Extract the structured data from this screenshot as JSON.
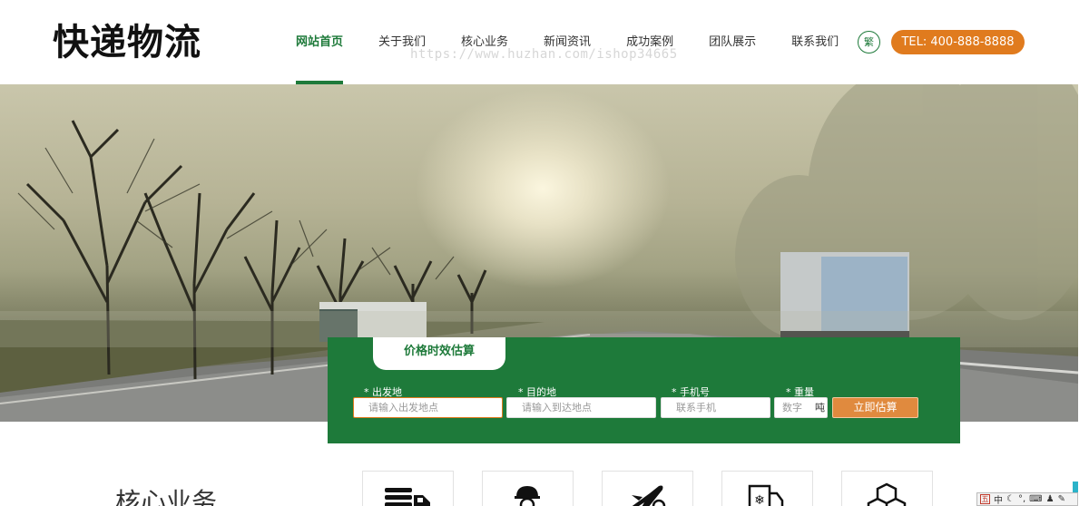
{
  "header": {
    "logo": "快递物流",
    "nav": [
      {
        "label": "网站首页",
        "active": true
      },
      {
        "label": "关于我们"
      },
      {
        "label": "核心业务"
      },
      {
        "label": "新闻资讯"
      },
      {
        "label": "成功案例"
      },
      {
        "label": "团队展示"
      },
      {
        "label": "联系我们"
      }
    ],
    "lang_toggle": "繁",
    "tel": "TEL: 400-888-8888",
    "watermark": "https://www.huzhan.com/ishop34665"
  },
  "calculator": {
    "tab": "价格时效估算",
    "fields": [
      {
        "label": "* 出发地",
        "placeholder": "请输入出发地点"
      },
      {
        "label": "* 目的地",
        "placeholder": "请输入到达地点"
      },
      {
        "label": "* 手机号",
        "placeholder": "联系手机"
      },
      {
        "label": "* 重量",
        "placeholder": "数字",
        "unit": "吨"
      }
    ],
    "submit": "立即估算"
  },
  "core": {
    "title": "核心业务",
    "services": [
      {
        "icon": "truck-stack-icon"
      },
      {
        "icon": "courier-person-icon"
      },
      {
        "icon": "airplane-icon"
      },
      {
        "icon": "cold-chain-truck-icon"
      },
      {
        "icon": "boxes-icon"
      }
    ]
  },
  "ime": {
    "badge": "五",
    "mode": "中"
  },
  "colors": {
    "brand_green": "#1e7a3a",
    "accent_orange": "#e07b1e"
  }
}
